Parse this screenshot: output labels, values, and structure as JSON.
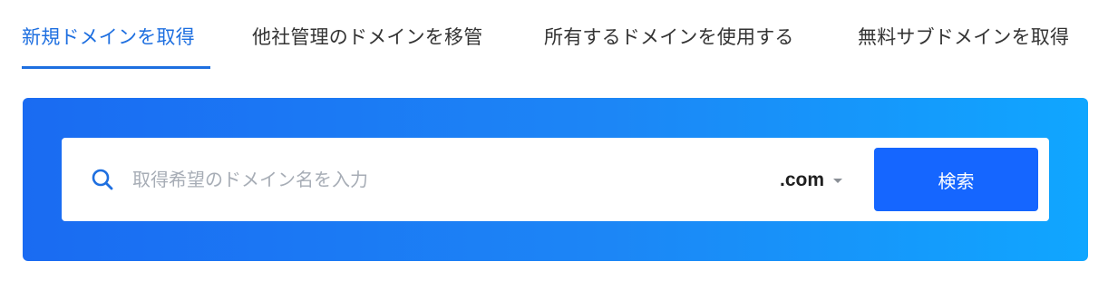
{
  "tabs": [
    {
      "label": "新規ドメインを取得",
      "active": true
    },
    {
      "label": "他社管理のドメインを移管",
      "active": false
    },
    {
      "label": "所有するドメインを使用する",
      "active": false
    },
    {
      "label": "無料サブドメインを取得",
      "active": false
    }
  ],
  "search": {
    "icon": "search-icon",
    "placeholder": "取得希望のドメイン名を入力",
    "value": "",
    "tld_selected": ".com",
    "button_label": "検索"
  },
  "colors": {
    "accent": "#1e6fe0",
    "panel_gradient_start": "#1a6bf2",
    "panel_gradient_end": "#10a6ff",
    "button": "#1566ff"
  }
}
